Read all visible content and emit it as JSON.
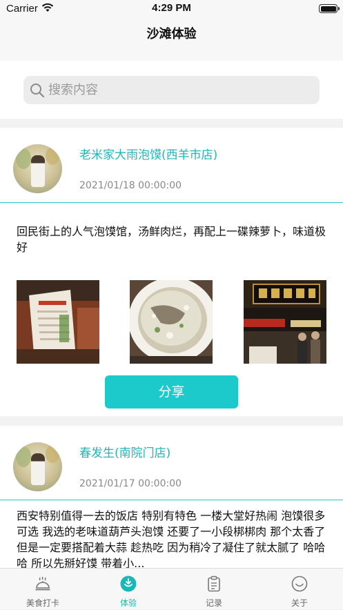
{
  "status_bar": {
    "carrier": "Carrier",
    "time": "4:29 PM"
  },
  "nav": {
    "title": "沙滩体验"
  },
  "search": {
    "placeholder": "搜索内容",
    "value": ""
  },
  "posts": [
    {
      "shop_name": "老米家大雨泡馍(西羊市店)",
      "date": "2021/01/18 00:00:00",
      "review": "回民街上的人气泡馍馆，汤鲜肉烂，再配上一碟辣萝卜，味道极好",
      "photos": [
        "menu-photo",
        "soup-bowl-photo",
        "storefront-photo"
      ],
      "share_label": "分享"
    },
    {
      "shop_name": "春发生(南院门店)",
      "date": "2021/01/17 00:00:00",
      "review": "西安特别值得一去的饭店 特别有特色 一楼大堂好热闹 泡馍很多可选 我选的老味道葫芦头泡馍 还要了一小段梆梆肉 那个太香了 但是一定要搭配着大蒜 趁热吃 因为稍冷了凝住了就太腻了 哈哈哈 所以先掰好馍 带着小..."
    }
  ],
  "tabs": [
    {
      "label": "美食打卡",
      "icon": "food-cloche-icon",
      "active": false
    },
    {
      "label": "体验",
      "icon": "experience-icon",
      "active": true
    },
    {
      "label": "记录",
      "icon": "clipboard-icon",
      "active": false
    },
    {
      "label": "关于",
      "icon": "smiley-icon",
      "active": false
    }
  ],
  "colors": {
    "accent": "#1ccacb",
    "link": "#20b6b8",
    "divider": "#2cc7c3"
  }
}
